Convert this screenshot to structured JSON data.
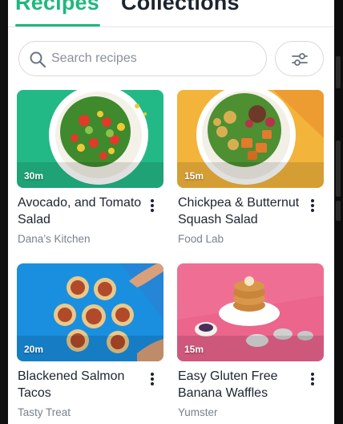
{
  "tabs": {
    "active": "Recipes",
    "inactive": "Collections"
  },
  "search": {
    "placeholder": "Search recipes"
  },
  "icons": {
    "search": "search-icon",
    "filter": "sliders-icon",
    "more": "more-vertical-icon"
  },
  "colors": {
    "accent": "#1fb87e",
    "text": "#1d2430",
    "subtext": "#7a828c"
  },
  "recipes": [
    {
      "title": "Avocado, and Tomato Salad",
      "source": "Dana’s Kitchen",
      "duration": "30m",
      "bg": "#23b987"
    },
    {
      "title": "Chickpea & Butternut Squash Salad",
      "source": "Food Lab",
      "duration": "15m",
      "bg": "#f3b43c"
    },
    {
      "title": "Blackened Salmon Tacos",
      "source": "Tasty Treat",
      "duration": "20m",
      "bg": "#1a8fe0"
    },
    {
      "title": "Easy Gluten Free Banana Waffles",
      "source": "Yumster",
      "duration": "15m",
      "bg": "#ef6f94"
    }
  ]
}
